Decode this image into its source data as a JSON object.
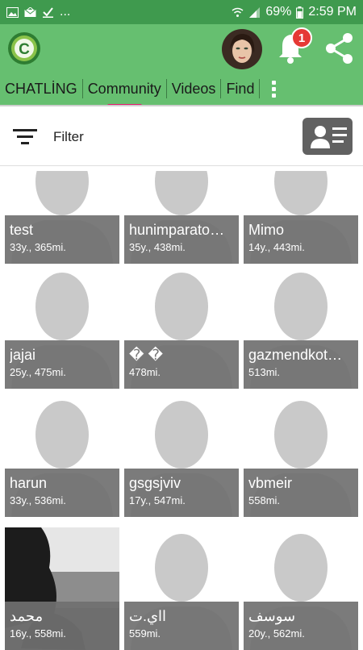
{
  "status_bar": {
    "dots": "...",
    "battery_percent": "69%",
    "time": "2:59 PM"
  },
  "app_bar": {
    "badge_count": "1",
    "tabs": [
      {
        "label": "CHATLİNG",
        "active": false
      },
      {
        "label": "Community",
        "active": true
      },
      {
        "label": "Videos",
        "active": false
      },
      {
        "label": "Find",
        "active": false
      }
    ]
  },
  "filter_bar": {
    "label": "Filter"
  },
  "profiles": [
    {
      "name": "test",
      "meta": "33y., 365mi.",
      "photo": false
    },
    {
      "name": "hunimparato…",
      "meta": "35y., 438mi.",
      "photo": false
    },
    {
      "name": "Mimo",
      "meta": "14y., 443mi.",
      "photo": false
    },
    {
      "name": "jajai",
      "meta": "25y., 475mi.",
      "photo": false
    },
    {
      "name": "� �",
      "meta": "478mi.",
      "photo": false
    },
    {
      "name": "gazmendkot…",
      "meta": "513mi.",
      "photo": false
    },
    {
      "name": "harun",
      "meta": "33y., 536mi.",
      "photo": false
    },
    {
      "name": "gsgsjviv",
      "meta": "17y., 547mi.",
      "photo": false
    },
    {
      "name": "vbmeir",
      "meta": "558mi.",
      "photo": false
    },
    {
      "name": "محمد",
      "meta": "16y., 558mi.",
      "photo": true
    },
    {
      "name": "ااي.ت",
      "meta": "559mi.",
      "photo": false
    },
    {
      "name": "سوسف",
      "meta": "20y., 562mi.",
      "photo": false
    }
  ],
  "colors": {
    "app_bar": "#66bf70",
    "status_bar": "#3f9a4e",
    "active_tab_indicator": "#e0196b",
    "badge": "#e53935"
  }
}
